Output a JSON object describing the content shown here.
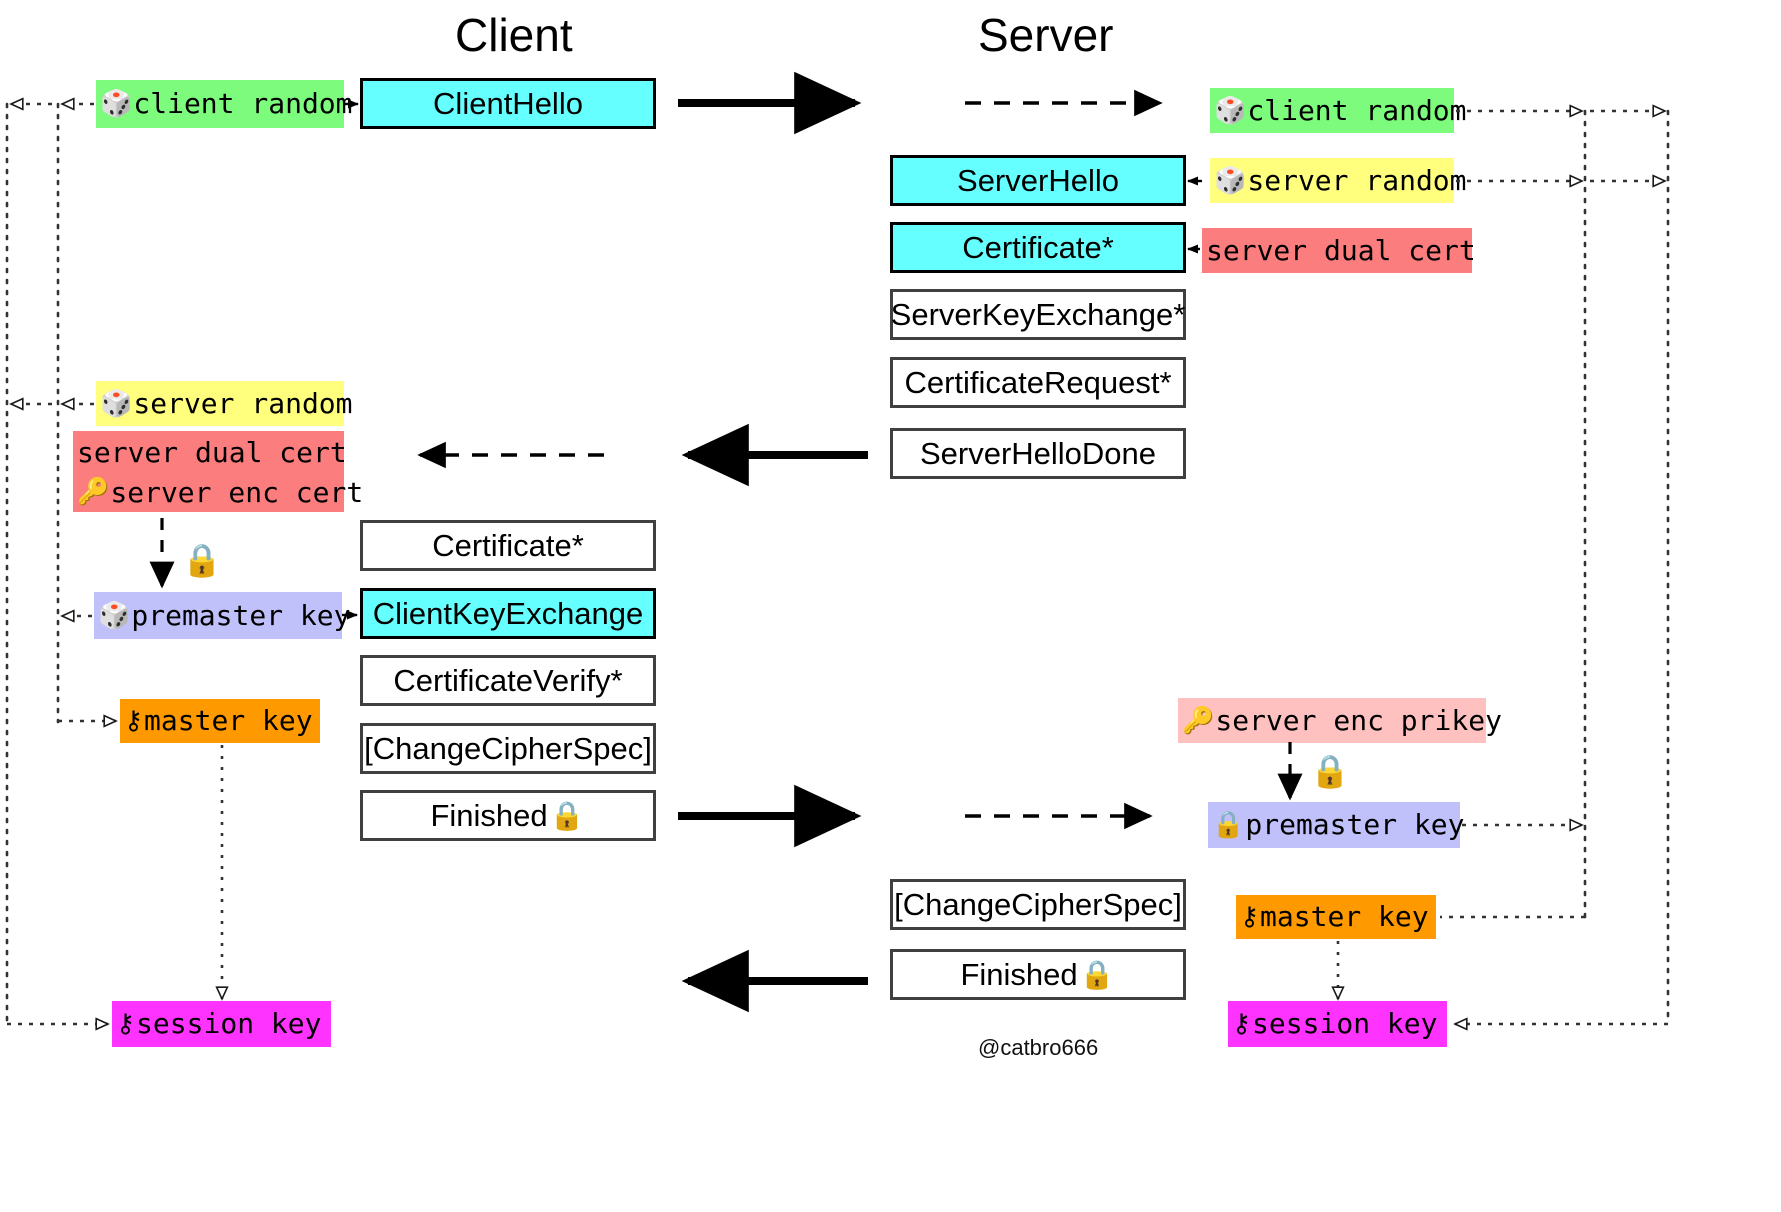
{
  "headers": {
    "client": "Client",
    "server": "Server"
  },
  "watermark": "@catbro666",
  "colors": {
    "green": "#7dfb7d",
    "yellow": "#ffff7d",
    "red": "#fb7d7d",
    "pink": "#ffc0c0",
    "purple": "#c0c0fb",
    "orange": "#ff9900",
    "magenta": "#ff33ff",
    "cyan": "#66ffff",
    "box_border": "#404040",
    "text": "#000000"
  },
  "client": {
    "messages": [
      {
        "id": "client-hello",
        "label": "ClientHello",
        "highlight": true
      },
      {
        "id": "certificate",
        "label": "Certificate*",
        "highlight": false
      },
      {
        "id": "client-key-exchange",
        "label": "ClientKeyExchange",
        "highlight": true
      },
      {
        "id": "certificate-verify",
        "label": "CertificateVerify*",
        "highlight": false
      },
      {
        "id": "change-cipher-spec",
        "label": "[ChangeCipherSpec]",
        "highlight": false
      },
      {
        "id": "finished",
        "label": "Finished",
        "icon": "lock-icon",
        "icon_glyph": "🔒",
        "highlight": false
      }
    ],
    "chips": [
      {
        "id": "client-random",
        "label": "client random",
        "icon": "dice-icon",
        "icon_glyph": "🎲",
        "color": "green"
      },
      {
        "id": "server-random",
        "label": "server random",
        "icon": "dice-icon",
        "icon_glyph": "🎲",
        "color": "yellow"
      },
      {
        "id": "server-certs",
        "line1": "server dual cert",
        "line2": "server enc cert",
        "icon": "key-icon",
        "icon_glyph": "🔑",
        "color": "red"
      },
      {
        "id": "premaster-key",
        "label": "premaster key",
        "icon": "dice-icon",
        "icon_glyph": "🎲",
        "color": "purple"
      },
      {
        "id": "master-key",
        "label": "master key",
        "icon": "key-outline-icon",
        "icon_glyph": "⚷",
        "color": "orange"
      },
      {
        "id": "session-key",
        "label": "session key",
        "icon": "key-outline-icon",
        "icon_glyph": "⚷",
        "color": "magenta"
      }
    ]
  },
  "server": {
    "messages": [
      {
        "id": "server-hello",
        "label": "ServerHello",
        "highlight": true
      },
      {
        "id": "certificate",
        "label": "Certificate*",
        "highlight": true
      },
      {
        "id": "server-key-exchange",
        "label": "ServerKeyExchange*",
        "highlight": false
      },
      {
        "id": "certificate-request",
        "label": "CertificateRequest*",
        "highlight": false
      },
      {
        "id": "server-hello-done",
        "label": "ServerHelloDone",
        "highlight": false
      },
      {
        "id": "change-cipher-spec",
        "label": "[ChangeCipherSpec]",
        "highlight": false
      },
      {
        "id": "finished",
        "label": "Finished",
        "icon": "lock-icon",
        "icon_glyph": "🔒",
        "highlight": false
      }
    ],
    "chips": [
      {
        "id": "client-random",
        "label": "client random",
        "icon": "dice-icon",
        "icon_glyph": "🎲",
        "color": "green"
      },
      {
        "id": "server-random",
        "label": "server random",
        "icon": "dice-icon",
        "icon_glyph": "🎲",
        "color": "yellow"
      },
      {
        "id": "server-dual-cert",
        "label": "server dual cert",
        "color": "red"
      },
      {
        "id": "server-enc-prikey",
        "label": "server enc prikey",
        "icon": "key-icon",
        "icon_glyph": "🔑",
        "color": "pink"
      },
      {
        "id": "premaster-key",
        "label": "premaster key",
        "icon": "lock-icon",
        "icon_glyph": "🔒",
        "color": "purple"
      },
      {
        "id": "master-key",
        "label": "master key",
        "icon": "key-outline-icon",
        "icon_glyph": "⚷",
        "color": "orange"
      },
      {
        "id": "session-key",
        "label": "session key",
        "icon": "key-outline-icon",
        "icon_glyph": "⚷",
        "color": "magenta"
      }
    ]
  },
  "decrypt_markers": [
    {
      "id": "client-decrypt-lock",
      "icon": "lock-icon",
      "icon_glyph": "🔒"
    },
    {
      "id": "server-decrypt-lock",
      "icon": "lock-icon",
      "icon_glyph": "🔒"
    }
  ]
}
